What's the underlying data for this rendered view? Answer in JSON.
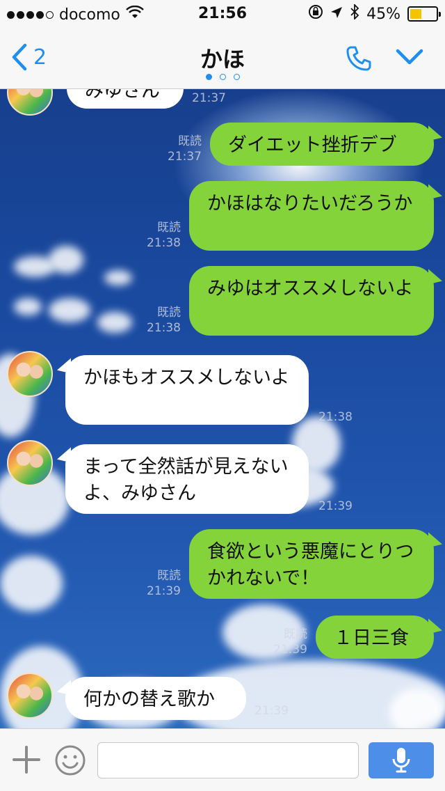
{
  "status_bar": {
    "carrier": "docomo",
    "time": "21:56",
    "battery": "45%",
    "battery_level": 0.45
  },
  "header": {
    "back_count": "2",
    "title": "かほ"
  },
  "messages": [
    {
      "side": "in",
      "text": "みゆさん",
      "time": "21:37"
    },
    {
      "side": "out",
      "read": "既読",
      "time": "21:37",
      "text": "ダイエット挫折デブ"
    },
    {
      "side": "out",
      "read": "既読",
      "time": "21:38",
      "text": "かほはなりたいだろうか"
    },
    {
      "side": "out",
      "read": "既読",
      "time": "21:38",
      "text": "みゆはオススメしないよ"
    },
    {
      "side": "in",
      "text": "かほもオススメしないよ",
      "time": "21:38"
    },
    {
      "side": "in",
      "text": "まって全然話が見えないよ、みゆさん",
      "time": "21:39"
    },
    {
      "side": "out",
      "read": "既読",
      "time": "21:39",
      "text": "食欲という悪魔にとりつかれないで！"
    },
    {
      "side": "out",
      "read": "既読",
      "time": "21:39",
      "text": "１日三食"
    },
    {
      "side": "in",
      "text": "何かの替え歌か",
      "time": "21:39"
    }
  ],
  "input": {
    "placeholder": ""
  }
}
